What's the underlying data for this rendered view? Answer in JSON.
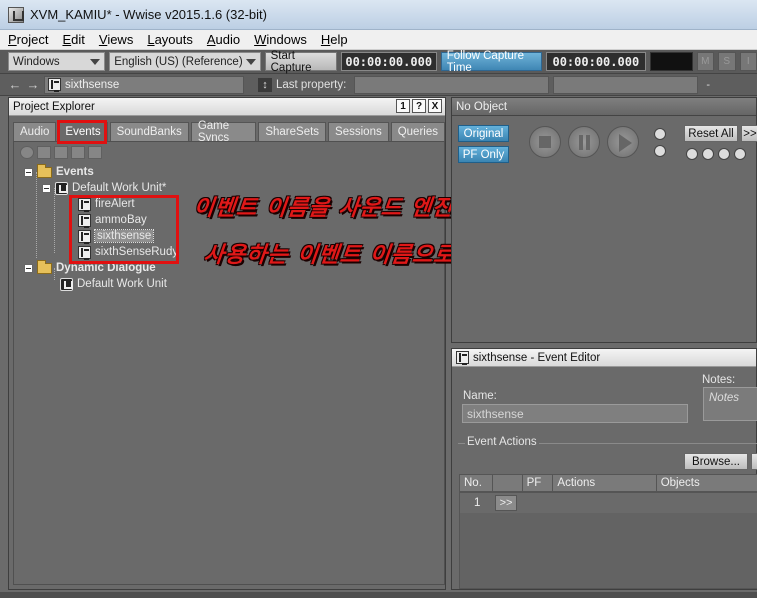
{
  "window": {
    "title": "XVM_KAMIU* - Wwise v2015.1.6 (32-bit)"
  },
  "menu": [
    "Project",
    "Edit",
    "Views",
    "Layouts",
    "Audio",
    "Windows",
    "Help"
  ],
  "toolbar": {
    "layout_combo": "Windows",
    "language_combo": "English (US) (Reference)",
    "start_capture": "Start Capture",
    "time_left": "00:00:00.000",
    "follow_capture": "Follow Capture Time",
    "time_right": "00:00:00.000",
    "mute": "M",
    "solo": "S",
    "other": "I"
  },
  "toolbar2": {
    "selected_object": "sixthsense",
    "last_property_label": "Last property:",
    "dash": "-"
  },
  "project_explorer": {
    "title": "Project Explorer",
    "header_buttons": [
      "1",
      "?",
      "X"
    ],
    "tabs": [
      "Audio",
      "Events",
      "SoundBanks",
      "Game Syncs",
      "ShareSets",
      "Sessions",
      "Queries"
    ],
    "active_tab": "Events",
    "tree": {
      "events_folder": "Events",
      "default_work_unit_modified": "Default Work Unit*",
      "events": [
        "fireAlert",
        "ammoBay",
        "sixthsense",
        "sixthSenseRudy"
      ],
      "selected_event": "sixthsense",
      "dialogue_folder": "Dynamic Dialogue",
      "default_work_unit": "Default Work Unit"
    }
  },
  "annotation": {
    "line1": "이벤트 이름을 사운드 엔진에서",
    "line2": "사용하는 이벤트 이름으로 생성~!!"
  },
  "transport": {
    "title": "No Object",
    "original": "Original",
    "pf_only": "PF Only",
    "reset_all": "Reset All",
    "more": ">>"
  },
  "event_editor": {
    "title": "sixthsense - Event Editor",
    "name_label": "Name:",
    "name_value": "sixthsense",
    "notes_label": "Notes:",
    "notes_placeholder": "Notes",
    "event_actions_label": "Event Actions",
    "browse": "Browse...",
    "columns": [
      "No.",
      "",
      "PF",
      "Actions",
      "Objects"
    ],
    "rows": [
      {
        "no": "1",
        "arrow": ">>"
      }
    ]
  },
  "colors": {
    "accent_blue": "#3f86b4",
    "annotation_red": "#e01818"
  }
}
